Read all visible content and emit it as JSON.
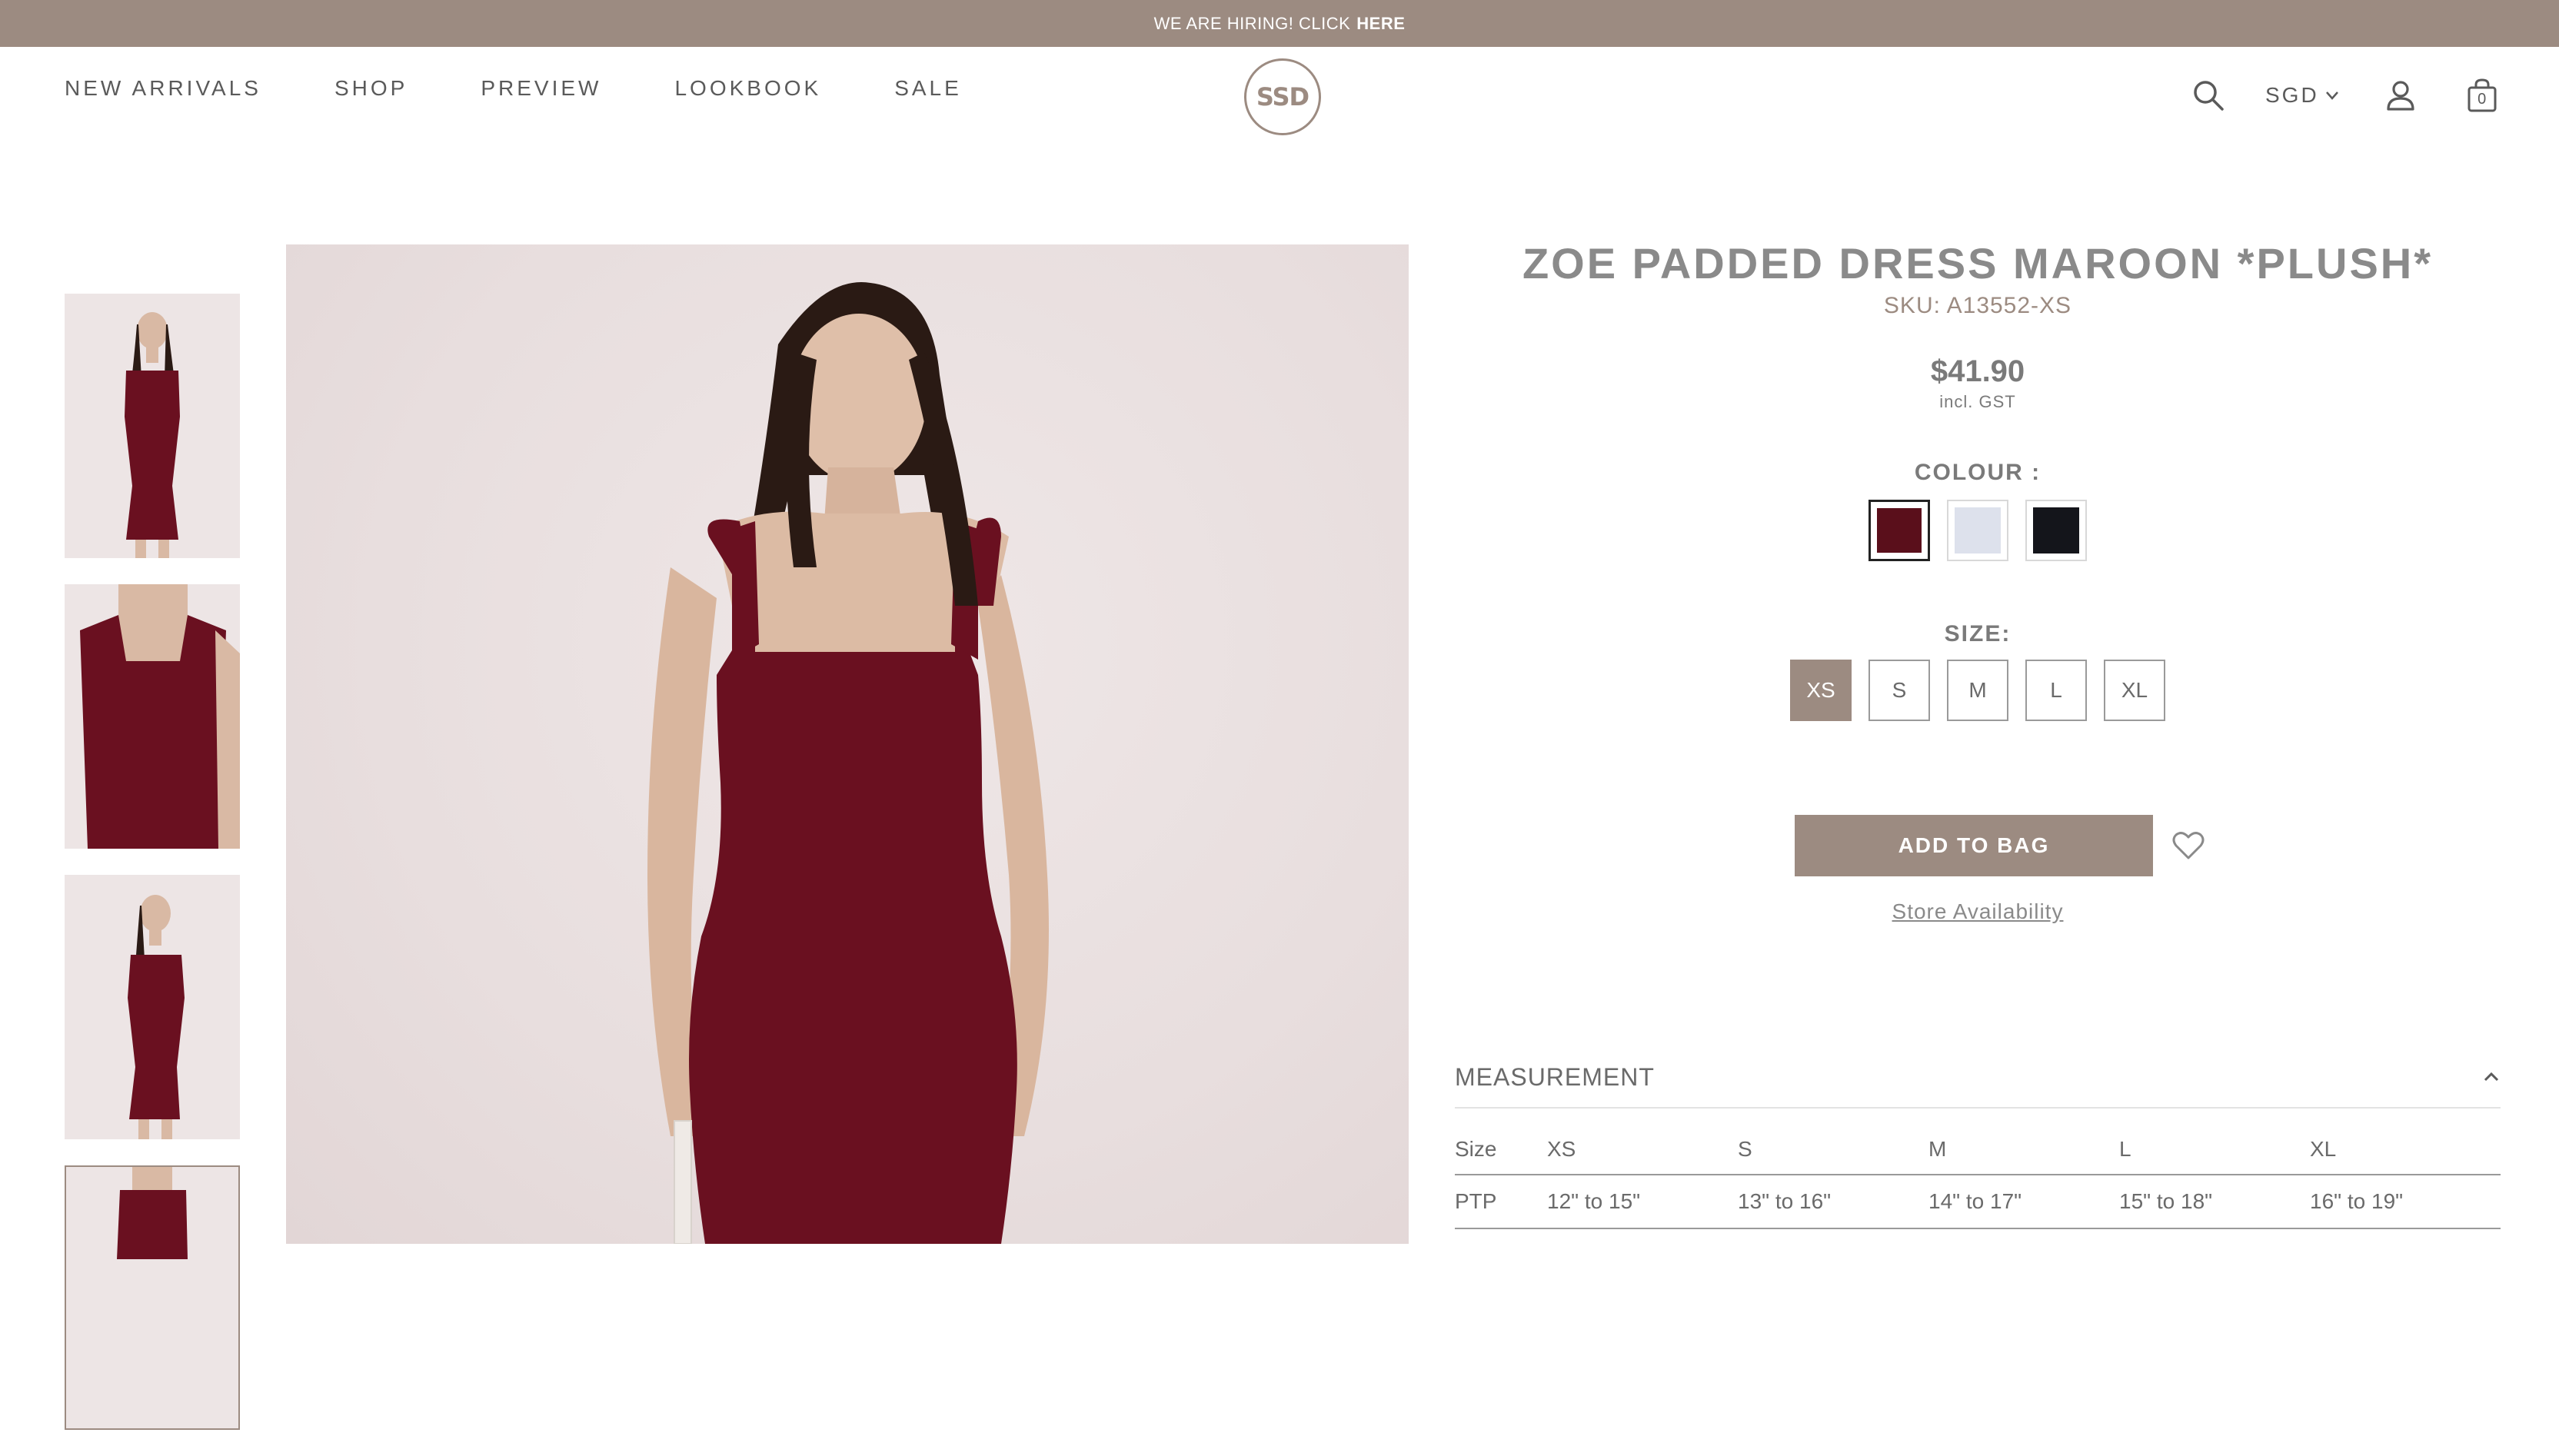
{
  "announcement": {
    "text": "WE ARE HIRING! CLICK",
    "link": "HERE"
  },
  "nav": [
    "NEW ARRIVALS",
    "SHOP",
    "PREVIEW",
    "LOOKBOOK",
    "SALE"
  ],
  "logo": {
    "text": "SSD"
  },
  "header": {
    "currency": "SGD",
    "cart_count": "0"
  },
  "icons": {
    "search": "search-icon",
    "currency": "chevron-down-icon",
    "account": "user-icon",
    "cart": "shopping-bag-icon",
    "wishlist": "heart-icon",
    "collapse": "chevron-up-icon"
  },
  "product": {
    "title": "ZOE PADDED DRESS MAROON *PLUSH*",
    "sku": "SKU: A13552-XS",
    "price": "$41.90",
    "tax_note": "incl. GST",
    "colour_label": "COLOUR :",
    "colours": [
      {
        "name": "maroon",
        "hex": "#5a0f1b",
        "selected": true
      },
      {
        "name": "light-blue",
        "hex": "#dde1ec",
        "selected": false
      },
      {
        "name": "black",
        "hex": "#14151b",
        "selected": false
      }
    ],
    "size_label": "SIZE:",
    "sizes": [
      "XS",
      "S",
      "M",
      "L",
      "XL"
    ],
    "selected_size": "XS",
    "add_to_bag": "ADD TO BAG",
    "store_availability": "Store Availability"
  },
  "measurement": {
    "title": "MEASUREMENT",
    "header": [
      "Size",
      "XS",
      "S",
      "M",
      "L",
      "XL"
    ],
    "rows": [
      [
        "PTP",
        "12\" to 15\"",
        "13\" to 16\"",
        "14\" to 17\"",
        "15\" to 18\"",
        "16\" to 19\""
      ]
    ]
  },
  "colors": {
    "brand": "#9c8b81",
    "dress": "#6a1020"
  }
}
